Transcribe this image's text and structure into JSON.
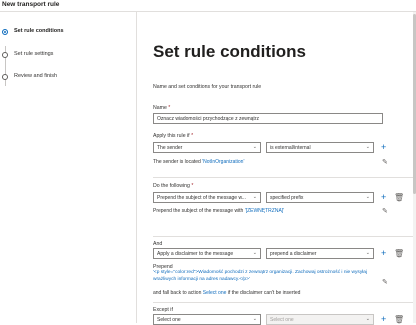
{
  "window": {
    "title": "New transport rule"
  },
  "steps": [
    {
      "label": "Set rule conditions",
      "active": true
    },
    {
      "label": "Set rule settings",
      "active": false
    },
    {
      "label": "Review and finish",
      "active": false
    }
  ],
  "page": {
    "title": "Set rule conditions",
    "subtitle": "Name and set conditions for your transport rule"
  },
  "name_field": {
    "label": "Name",
    "value": "Oznacz wiadomości przychodzące z zewnątrz"
  },
  "condition": {
    "label": "Apply this rule if",
    "dropdown1": "The sender",
    "dropdown2": "is external/internal",
    "summary_prefix": "The sender is located ",
    "summary_link": "'NotInOrganization'"
  },
  "action": {
    "label": "Do the following",
    "dropdown1": "Prepend the subject of the message w...",
    "dropdown2": "specified prefix",
    "summary_prefix": "Prepend the subject of the message with ",
    "summary_link": "'[ZEWNĘTRZNA]'"
  },
  "and_action": {
    "label": "And",
    "dropdown1": "Apply a disclaimer to the message",
    "dropdown2": "prepend a disclaimer",
    "prepend_label": "Prepend",
    "disclaimer_html": "'<p style=\"color:red\">Wiadomość pochodzi z zewnątrz organizacji. Zachowaj ostrożność i nie wysyłaj wrażliwych informacji na adres nadawcy.</p>'",
    "fallback_prefix": "and fall back to action ",
    "fallback_link": "Select one",
    "fallback_suffix": " if the disclaimer can't be inserted"
  },
  "exception": {
    "label": "Except if",
    "dropdown1": "Select one",
    "dropdown2": "Select one"
  },
  "icons": {
    "add": "+",
    "delete": "🗑",
    "edit": "✎",
    "chevron": "⌄"
  },
  "colors": {
    "accent": "#0f6cbd",
    "required": "#a4262c"
  }
}
